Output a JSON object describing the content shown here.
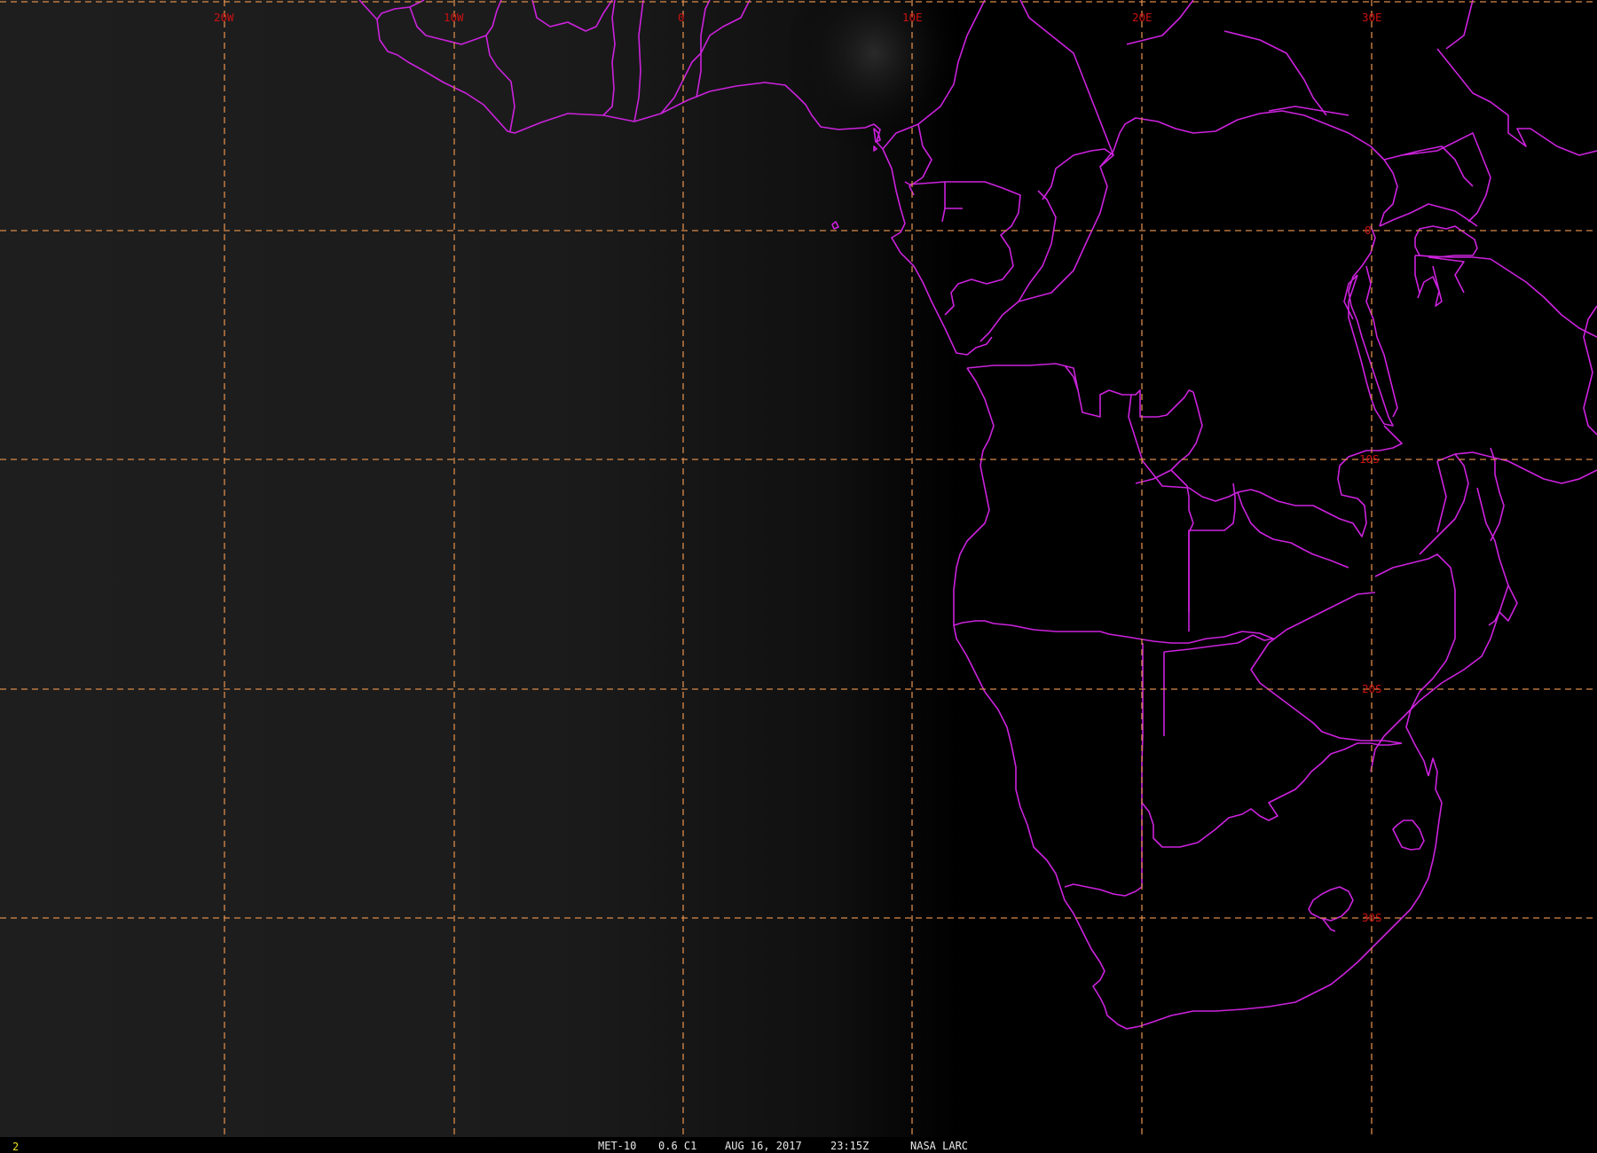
{
  "map": {
    "longitude_labels": [
      "20W",
      "10W",
      "0",
      "10E",
      "20E",
      "30E"
    ],
    "latitude_labels": [
      "0",
      "10S",
      "20S",
      "30S"
    ],
    "colors": {
      "background": "#000000",
      "grid": "#d98a4a",
      "boundaries": "#cc22dd",
      "grid_labels": "#cc1111"
    }
  },
  "footer": {
    "frame_number": "2",
    "satellite": "MET-10",
    "channel": "0.6 C1",
    "date": "AUG 16, 2017",
    "time": "23:15Z",
    "source": "NASA LARC"
  }
}
